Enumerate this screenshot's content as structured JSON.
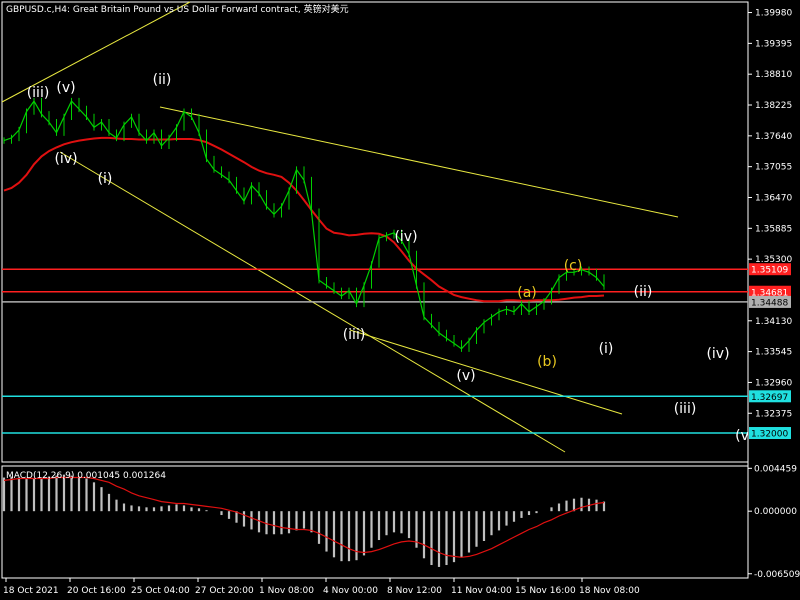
{
  "chart_data": [
    {
      "type": "line",
      "title": "GBPUSD.c,H4:  Great Britain Pound vs US Dollar Forward contract, 英镑对美元",
      "ylim": [
        1.3145,
        1.4018
      ],
      "y_ticks": [
        "1.39980",
        "1.39395",
        "1.38810",
        "1.38225",
        "1.37640",
        "1.37055",
        "1.36470",
        "1.35885",
        "1.35300",
        "1.34130",
        "1.33545",
        "1.32960",
        "1.32375"
      ],
      "x_ticks": [
        "18 Oct 2021",
        "20 Oct 16:00",
        "25 Oct 04:00",
        "27 Oct 20:00",
        "1 Nov 08:00",
        "4 Nov 00:00",
        "8 Nov 12:00",
        "11 Nov 04:00",
        "15 Nov 16:00",
        "18 Nov 08:00"
      ],
      "price_series": {
        "name": "price",
        "color": "#00d000",
        "close": [
          1.3755,
          1.376,
          1.3775,
          1.381,
          1.383,
          1.3805,
          1.379,
          1.377,
          1.38,
          1.383,
          1.3815,
          1.38,
          1.378,
          1.379,
          1.377,
          1.376,
          1.3785,
          1.38,
          1.377,
          1.3755,
          1.377,
          1.3745,
          1.376,
          1.378,
          1.381,
          1.38,
          1.377,
          1.372,
          1.37,
          1.369,
          1.368,
          1.366,
          1.364,
          1.367,
          1.3655,
          1.363,
          1.3615,
          1.363,
          1.366,
          1.37,
          1.368,
          1.362,
          1.349,
          1.348,
          1.347,
          1.346,
          1.347,
          1.3445,
          1.348,
          1.352,
          1.357,
          1.3575,
          1.358,
          1.3565,
          1.354,
          1.348,
          1.342,
          1.3405,
          1.339,
          1.338,
          1.337,
          1.336,
          1.3375,
          1.3395,
          1.341,
          1.342,
          1.343,
          1.3435,
          1.343,
          1.3445,
          1.343,
          1.344,
          1.345,
          1.347,
          1.3495,
          1.3505,
          1.3505,
          1.351,
          1.3505,
          1.3495,
          1.3478
        ]
      },
      "moving_average": {
        "name": "",
        "color": "#e01010",
        "values": [
          1.366,
          1.3665,
          1.3675,
          1.369,
          1.371,
          1.3725,
          1.3735,
          1.3742,
          1.3748,
          1.3752,
          1.3755,
          1.3757,
          1.3759,
          1.376,
          1.376,
          1.3759,
          1.3758,
          1.3758,
          1.3757,
          1.3757,
          1.3757,
          1.3757,
          1.3757,
          1.3758,
          1.3758,
          1.3758,
          1.3756,
          1.3752,
          1.3745,
          1.3738,
          1.373,
          1.3722,
          1.3714,
          1.3705,
          1.3698,
          1.3693,
          1.369,
          1.3686,
          1.3675,
          1.366,
          1.3642,
          1.3623,
          1.3605,
          1.3588,
          1.358,
          1.3578,
          1.3575,
          1.3576,
          1.3578,
          1.3579,
          1.3578,
          1.3573,
          1.3562,
          1.3545,
          1.3527,
          1.3512,
          1.3501,
          1.349,
          1.3478,
          1.347,
          1.3462,
          1.3458,
          1.3455,
          1.3452,
          1.345,
          1.345,
          1.345,
          1.3452,
          1.3452,
          1.3451,
          1.3451,
          1.3452,
          1.3452,
          1.3452,
          1.3453,
          1.3455,
          1.3457,
          1.3458,
          1.346,
          1.346,
          1.3461
        ]
      },
      "horizontal_levels": [
        {
          "label": "1.35109",
          "value": 1.35109,
          "color": "#ff2020"
        },
        {
          "label": "1.34681",
          "value": 1.34681,
          "color": "#ff2020"
        },
        {
          "label": "1.34488",
          "value": 1.34488,
          "color": "#b0b0b0"
        },
        {
          "label": "1.32697",
          "value": 1.32697,
          "color": "#20e0e0"
        },
        {
          "label": "1.32000",
          "value": 1.32,
          "color": "#20e0e0"
        }
      ],
      "wave_labels": [
        {
          "text": "(iii)",
          "color": "#ffffff"
        },
        {
          "text": "(v)",
          "color": "#ffffff"
        },
        {
          "text": "(iv)",
          "color": "#ffffff"
        },
        {
          "text": "(ii)",
          "color": "#ffffff"
        },
        {
          "text": "(i)",
          "color": "#ffffff"
        },
        {
          "text": "(iv)",
          "color": "#ffffff"
        },
        {
          "text": "(iii)",
          "color": "#ffffff"
        },
        {
          "text": "(v)",
          "color": "#ffffff"
        },
        {
          "text": "(a)",
          "color": "#e8c820"
        },
        {
          "text": "(b)",
          "color": "#e8c820"
        },
        {
          "text": "(c)",
          "color": "#e8c820"
        },
        {
          "text": "(ii)",
          "color": "#ffffff"
        },
        {
          "text": "(i)",
          "color": "#ffffff"
        },
        {
          "text": "(iv)",
          "color": "#ffffff"
        },
        {
          "text": "(iii)",
          "color": "#ffffff"
        },
        {
          "text": "(v",
          "color": "#ffffff"
        }
      ]
    },
    {
      "type": "bar",
      "title": "MACD(12,26,9) 0.001045 0.001264",
      "ylim": [
        -0.00695,
        0.0047
      ],
      "y_ticks": [
        "0.004459",
        "0.000000",
        "-0.006509"
      ],
      "histogram": {
        "name": "MACD",
        "color": "#c0c0c0",
        "values": [
          0.0035,
          0.0036,
          0.0035,
          0.0034,
          0.0034,
          0.0035,
          0.0036,
          0.0037,
          0.0038,
          0.0037,
          0.0036,
          0.0034,
          0.003,
          0.0025,
          0.0018,
          0.0012,
          0.0008,
          0.0006,
          0.0005,
          0.0004,
          0.0004,
          0.0005,
          0.0006,
          0.0007,
          0.0006,
          0.0004,
          0.0003,
          0.0001,
          0.0,
          -0.0004,
          -0.0008,
          -0.0012,
          -0.0016,
          -0.0019,
          -0.0022,
          -0.0024,
          -0.0024,
          -0.0024,
          -0.0023,
          -0.002,
          -0.0018,
          -0.0022,
          -0.0034,
          -0.0042,
          -0.0048,
          -0.0052,
          -0.0052,
          -0.0051,
          -0.0046,
          -0.0038,
          -0.003,
          -0.0025,
          -0.0022,
          -0.0023,
          -0.0028,
          -0.0038,
          -0.0049,
          -0.0056,
          -0.0058,
          -0.0056,
          -0.0053,
          -0.0048,
          -0.0043,
          -0.0037,
          -0.0031,
          -0.0025,
          -0.002,
          -0.0015,
          -0.0011,
          -0.0007,
          -0.0004,
          -0.0002,
          0.0,
          0.0004,
          0.0008,
          0.0011,
          0.0013,
          0.0014,
          0.0013,
          0.0012,
          0.001
        ]
      },
      "signal": {
        "name": "Signal",
        "color": "#e01010",
        "values": [
          0.0032,
          0.0033,
          0.0034,
          0.0034,
          0.0034,
          0.0034,
          0.0034,
          0.0035,
          0.0035,
          0.0035,
          0.0035,
          0.0035,
          0.0034,
          0.0032,
          0.003,
          0.0026,
          0.0023,
          0.0019,
          0.0016,
          0.0014,
          0.0012,
          0.001,
          0.0009,
          0.0008,
          0.0008,
          0.0007,
          0.0006,
          0.0005,
          0.0004,
          0.0003,
          0.0001,
          -0.0001,
          -0.0004,
          -0.0007,
          -0.001,
          -0.0013,
          -0.0015,
          -0.0017,
          -0.0018,
          -0.0019,
          -0.0019,
          -0.002,
          -0.0023,
          -0.0027,
          -0.0031,
          -0.0035,
          -0.0039,
          -0.0042,
          -0.0043,
          -0.0042,
          -0.004,
          -0.0037,
          -0.0034,
          -0.0032,
          -0.0031,
          -0.0032,
          -0.0035,
          -0.0039,
          -0.0043,
          -0.0046,
          -0.0047,
          -0.0048,
          -0.0047,
          -0.0045,
          -0.0042,
          -0.0039,
          -0.0035,
          -0.0031,
          -0.0027,
          -0.0023,
          -0.0019,
          -0.0016,
          -0.0012,
          -0.0009,
          -0.0005,
          -0.0002,
          0.0001,
          0.0004,
          0.0006,
          0.0008,
          0.0009
        ]
      }
    }
  ]
}
